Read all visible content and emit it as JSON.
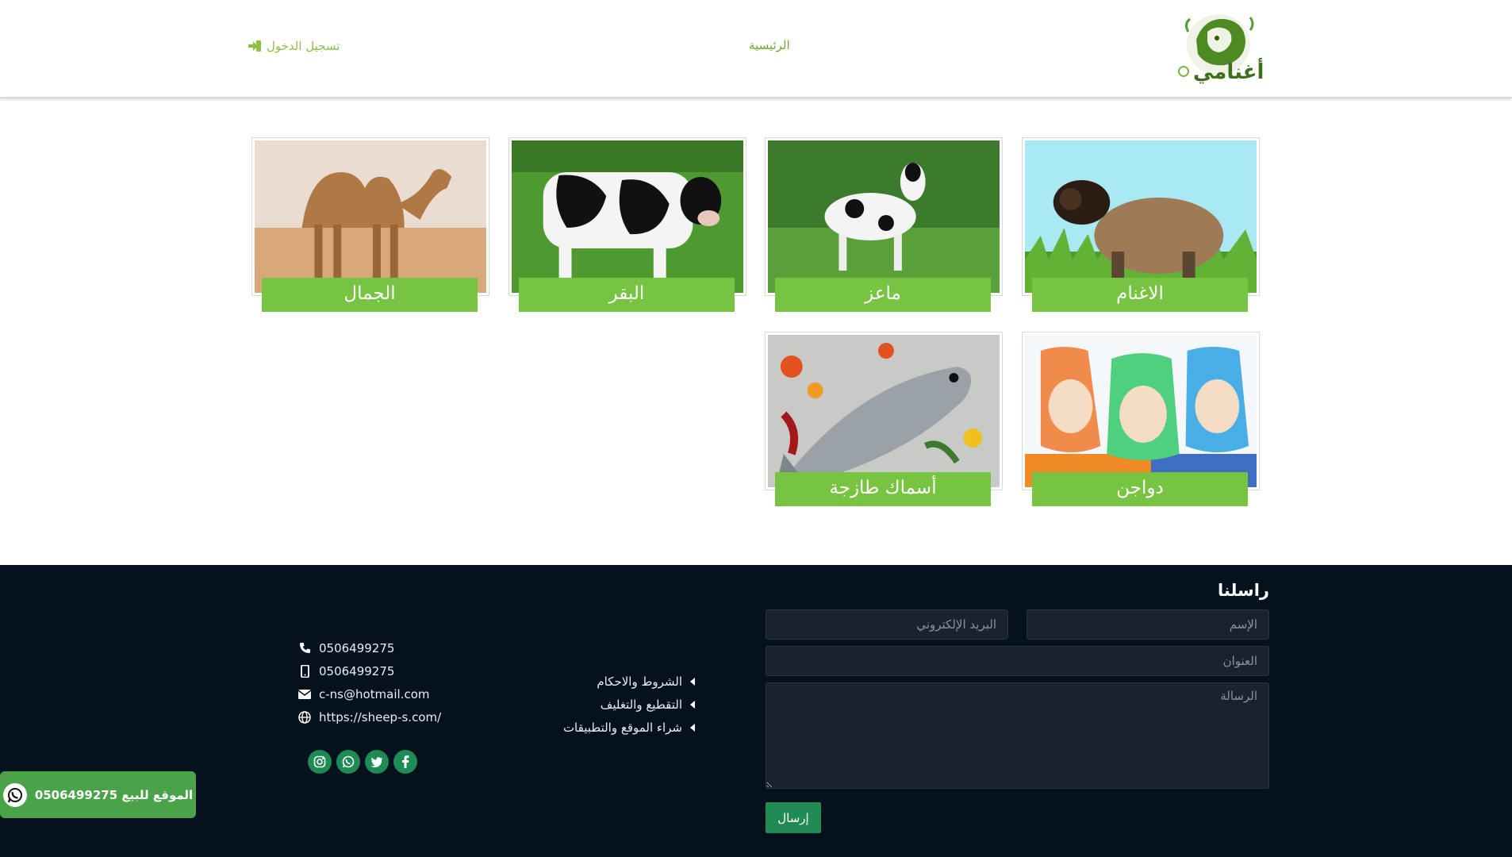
{
  "header": {
    "logo_text": "أغنامي",
    "nav_home": "الرئيسية",
    "nav_login": "تسجيل الدخول"
  },
  "categories": [
    {
      "label": "الاغنام",
      "image": "sheep"
    },
    {
      "label": "ماعز",
      "image": "goat"
    },
    {
      "label": "البقر",
      "image": "cow"
    },
    {
      "label": "الجمال",
      "image": "camel"
    },
    {
      "label": "دواجن",
      "image": "poultry"
    },
    {
      "label": "أسماك طازجة",
      "image": "fish"
    }
  ],
  "contact_form": {
    "title": "راسلنا",
    "name_placeholder": "الإسم",
    "email_placeholder": "البريد الإلكتروني",
    "subject_placeholder": "العنوان",
    "message_placeholder": "الرسالة",
    "send_label": "إرسال"
  },
  "links": [
    "الشروط والاحكام",
    "التقطيع والتغليف",
    "شراء الموقع والتطبيقات"
  ],
  "contact_info": {
    "phone": "0506499275",
    "mobile": "0506499275",
    "email": "c-ns@hotmail.com",
    "website": "https://sheep-s.com/"
  },
  "socials": [
    "instagram-icon",
    "whatsapp-icon",
    "twitter-icon",
    "facebook-icon"
  ],
  "sale_badge": {
    "text": "الموقع للبيع 0506499275"
  },
  "colors": {
    "accent_green": "#76c442",
    "footer_bg": "#06111e",
    "button_green": "#1e8a54",
    "badge_green": "#4aa348"
  }
}
